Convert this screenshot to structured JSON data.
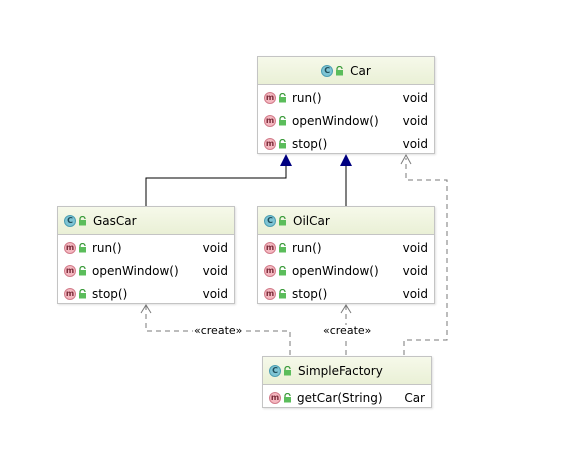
{
  "classes": {
    "car": {
      "name": "Car",
      "methods": [
        {
          "name": "run()",
          "type": "void"
        },
        {
          "name": "openWindow()",
          "type": "void"
        },
        {
          "name": "stop()",
          "type": "void"
        }
      ]
    },
    "gascar": {
      "name": "GasCar",
      "methods": [
        {
          "name": "run()",
          "type": "void"
        },
        {
          "name": "openWindow()",
          "type": "void"
        },
        {
          "name": "stop()",
          "type": "void"
        }
      ]
    },
    "oilcar": {
      "name": "OilCar",
      "methods": [
        {
          "name": "run()",
          "type": "void"
        },
        {
          "name": "openWindow()",
          "type": "void"
        },
        {
          "name": "stop()",
          "type": "void"
        }
      ]
    },
    "factory": {
      "name": "SimpleFactory",
      "methods": [
        {
          "name": "getCar(String)",
          "type": "Car"
        }
      ]
    }
  },
  "edges": {
    "create_label": "«create»"
  },
  "icons": {
    "class_icon": "class-c-icon",
    "method_icon": "method-m-icon",
    "visibility_icon": "public-lock-icon"
  },
  "colors": {
    "inheritance": "#000080",
    "dependency": "#808080",
    "header_bg": "#eef3dd",
    "class_icon": "#7ec4d4",
    "method_icon": "#f4b8c0"
  }
}
